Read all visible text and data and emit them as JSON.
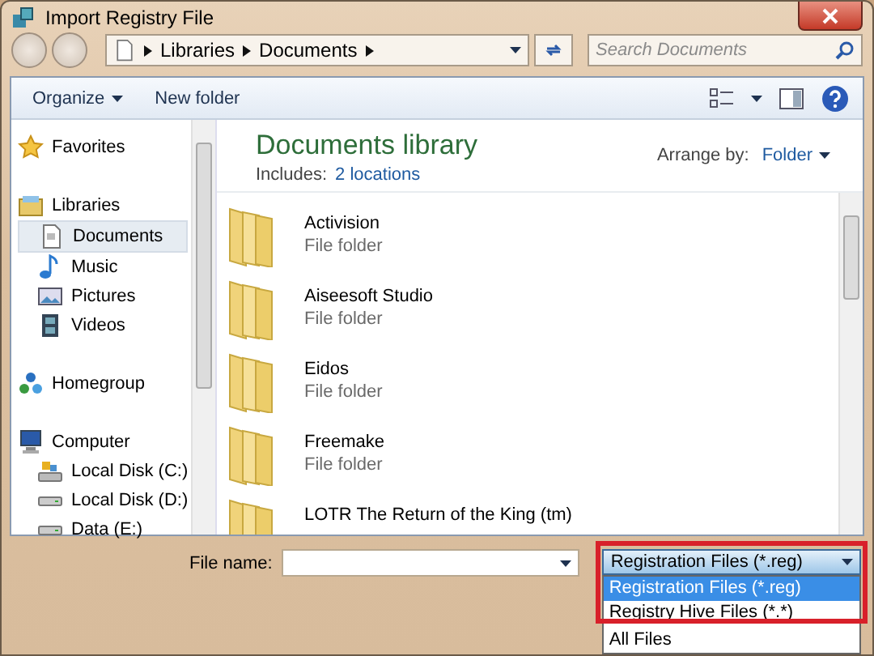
{
  "window": {
    "title": "Import Registry File"
  },
  "address": {
    "breadcrumbs": [
      "Libraries",
      "Documents"
    ]
  },
  "search": {
    "placeholder": "Search Documents"
  },
  "toolbar": {
    "items": [
      "Organize",
      "New folder"
    ]
  },
  "sidebar": {
    "groups": [
      {
        "label": "Favorites",
        "kind": "star"
      },
      {
        "label": "Libraries",
        "kind": "library",
        "children": [
          {
            "label": "Documents",
            "kind": "document",
            "selected": true
          },
          {
            "label": "Music",
            "kind": "music",
            "selected": false
          },
          {
            "label": "Pictures",
            "kind": "pictures",
            "selected": false
          },
          {
            "label": "Videos",
            "kind": "videos",
            "selected": false
          }
        ]
      },
      {
        "label": "Homegroup",
        "kind": "homegroup"
      },
      {
        "label": "Computer",
        "kind": "computer",
        "children": [
          {
            "label": "Local Disk (C:)",
            "kind": "sysdisk",
            "selected": false
          },
          {
            "label": "Local Disk (D:)",
            "kind": "disk",
            "selected": false
          },
          {
            "label": "Data (E:)",
            "kind": "disk",
            "selected": false
          }
        ]
      }
    ]
  },
  "content": {
    "title": "Documents library",
    "includes_label": "Includes:",
    "includes_link": "2 locations",
    "arrange_label": "Arrange by:",
    "arrange_value": "Folder",
    "files": [
      {
        "name": "Activision",
        "type": "File folder"
      },
      {
        "name": "Aiseesoft Studio",
        "type": "File folder"
      },
      {
        "name": "Eidos",
        "type": "File folder"
      },
      {
        "name": "Freemake",
        "type": "File folder"
      },
      {
        "name": "LOTR The Return of the King (tm)"
      }
    ]
  },
  "footer": {
    "file_name_label": "File name:",
    "filter": {
      "value": "Registration Files (*.reg)",
      "expanded": true,
      "options": [
        {
          "label": "Registration Files (*.reg)",
          "selected": true
        },
        {
          "label": "Registry Hive Files (*.*)",
          "selected": false
        },
        {
          "label": "All Files",
          "selected": false
        }
      ]
    }
  }
}
